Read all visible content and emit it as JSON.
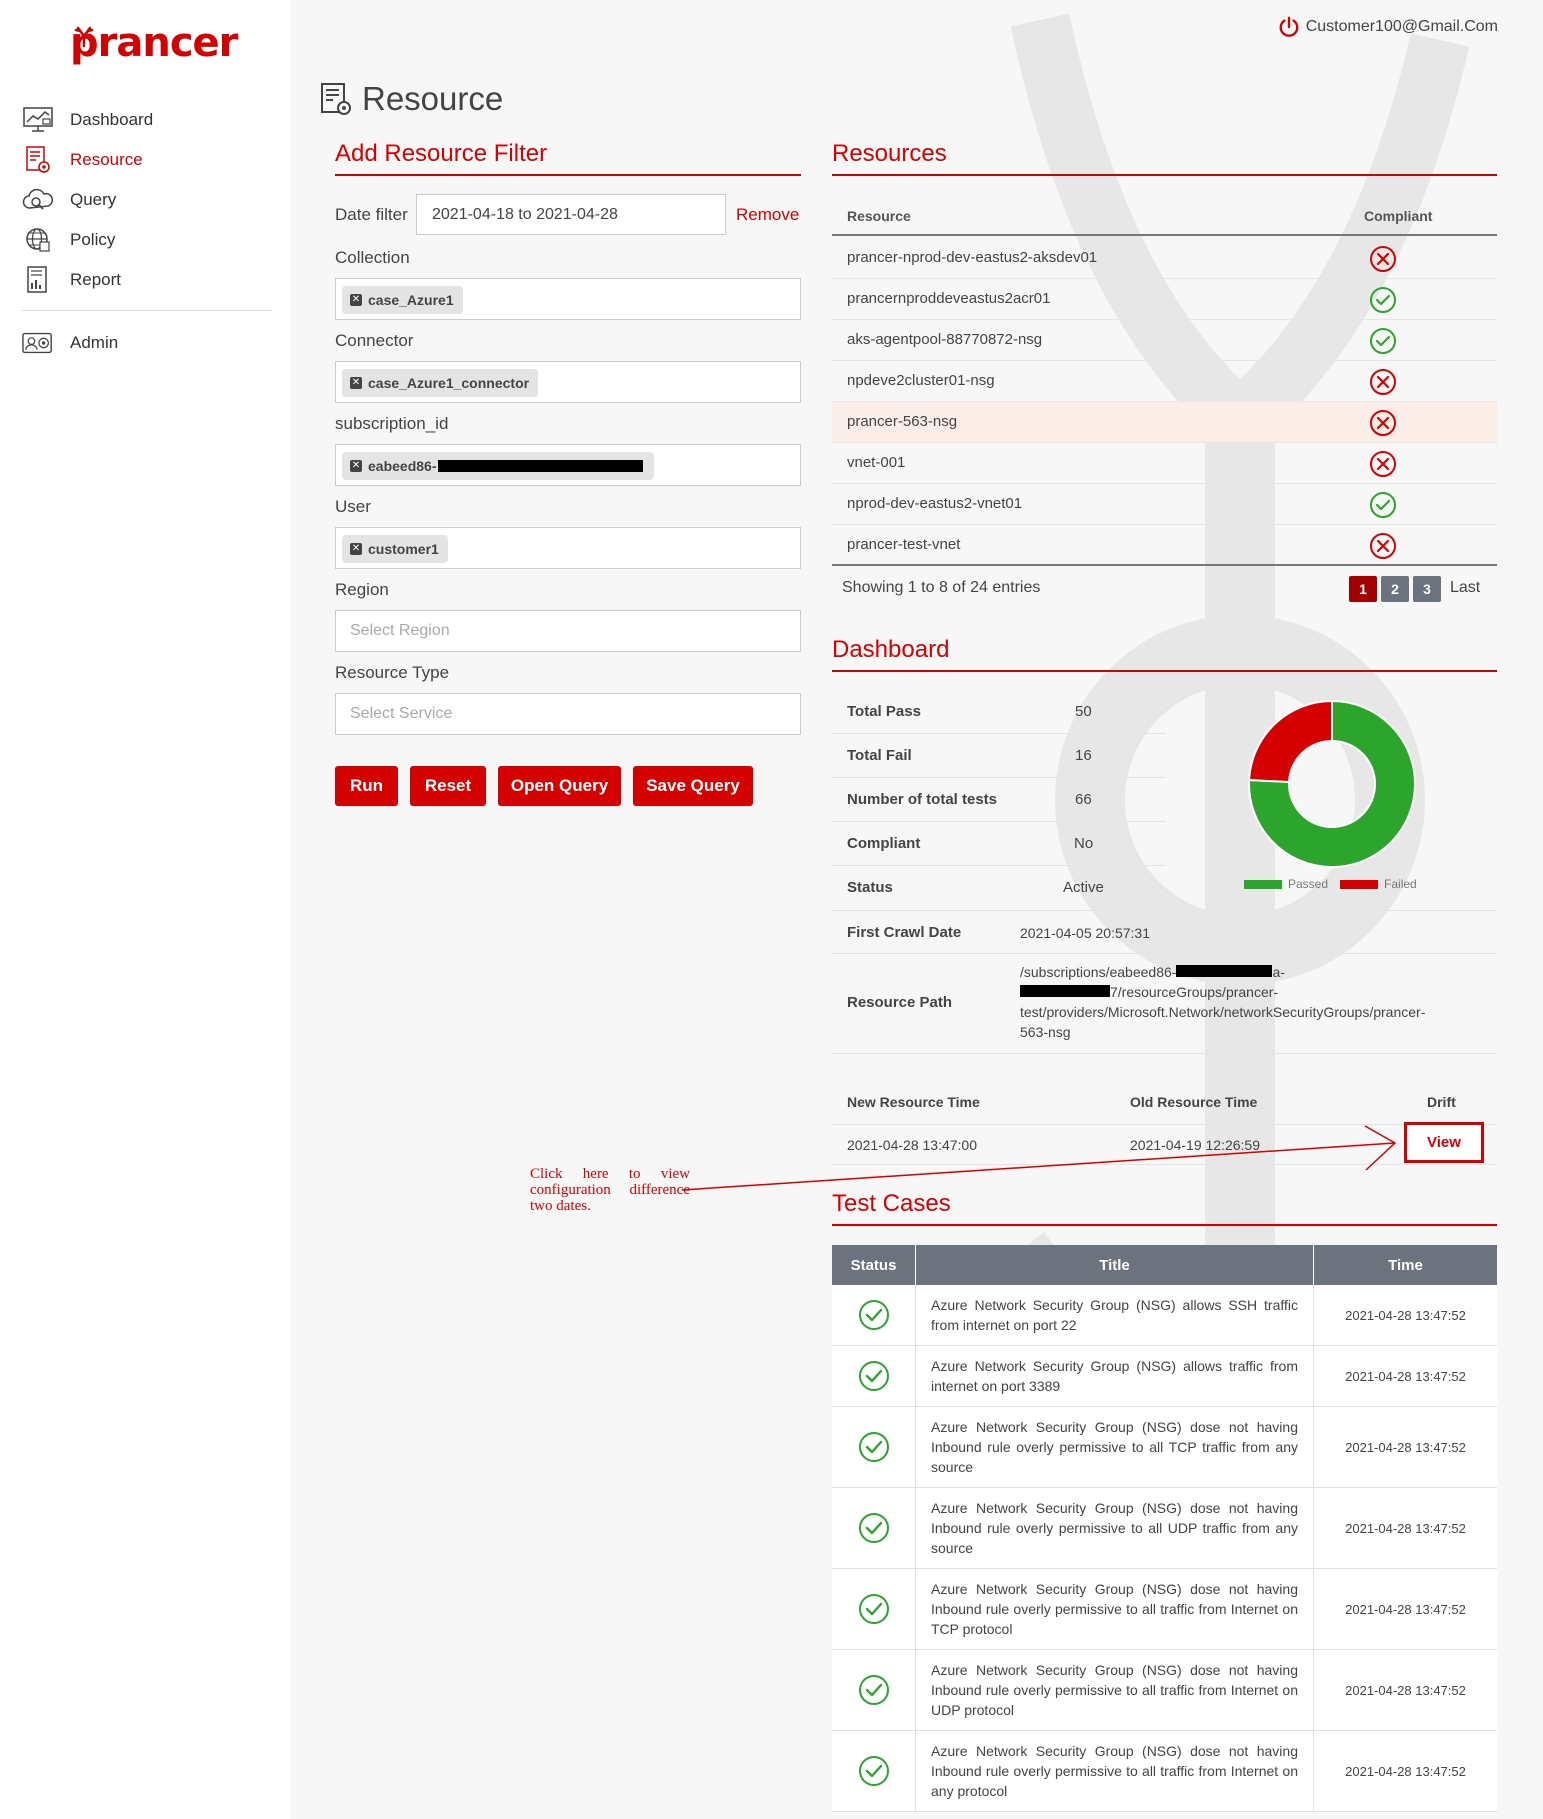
{
  "app": {
    "logo": "prancer",
    "user": "Customer100@Gmail.Com"
  },
  "sidebar": {
    "items": [
      {
        "label": "Dashboard",
        "icon": "dashboard-icon"
      },
      {
        "label": "Resource",
        "icon": "resource-icon"
      },
      {
        "label": "Query",
        "icon": "query-icon"
      },
      {
        "label": "Policy",
        "icon": "policy-icon"
      },
      {
        "label": "Report",
        "icon": "report-icon"
      },
      {
        "label": "Admin",
        "icon": "admin-icon"
      }
    ],
    "active": "Resource"
  },
  "page": {
    "title": "Resource"
  },
  "filter": {
    "title": "Add Resource Filter",
    "date_label": "Date filter",
    "date_value": "2021-04-18 to 2021-04-28",
    "remove": "Remove",
    "collection_label": "Collection",
    "collection_tag": "case_Azure1",
    "connector_label": "Connector",
    "connector_tag": "case_Azure1_connector",
    "subscription_label": "subscription_id",
    "subscription_tag": "eabeed86-",
    "user_label": "User",
    "user_tag": "customer1",
    "region_label": "Region",
    "region_placeholder": "Select Region",
    "type_label": "Resource Type",
    "type_placeholder": "Select Service",
    "buttons": {
      "run": "Run",
      "reset": "Reset",
      "open": "Open Query",
      "save": "Save Query"
    }
  },
  "resources": {
    "title": "Resources",
    "col_resource": "Resource",
    "col_compliant": "Compliant",
    "rows": [
      {
        "name": "prancer-nprod-dev-eastus2-aksdev01",
        "compliant": false
      },
      {
        "name": "prancernproddeveastus2acr01",
        "compliant": true
      },
      {
        "name": "aks-agentpool-88770872-nsg",
        "compliant": true
      },
      {
        "name": "npdeve2cluster01-nsg",
        "compliant": false
      },
      {
        "name": "prancer-563-nsg",
        "compliant": false,
        "selected": true
      },
      {
        "name": "vnet-001",
        "compliant": false
      },
      {
        "name": "nprod-dev-eastus2-vnet01",
        "compliant": true
      },
      {
        "name": "prancer-test-vnet",
        "compliant": false
      }
    ],
    "showing": "Showing 1 to 8 of 24 entries",
    "pages": [
      "1",
      "2",
      "3"
    ],
    "last": "Last"
  },
  "dashboard": {
    "title": "Dashboard",
    "total_pass_label": "Total Pass",
    "total_pass": "50",
    "total_fail_label": "Total Fail",
    "total_fail": "16",
    "total_tests_label": "Number of total tests",
    "total_tests": "66",
    "compliant_label": "Compliant",
    "compliant": "No",
    "status_label": "Status",
    "status": "Active",
    "first_crawl_label": "First Crawl Date",
    "first_crawl": "2021-04-05 20:57:31",
    "path_label": "Resource Path",
    "path_line1": "/subscriptions/eabeed86-",
    "path_line1_end": "a-",
    "path_line2": "7/resourceGroups/prancer-",
    "path_line3": "test/providers/Microsoft.Network/networkSecurityGroups/prancer-",
    "path_line4": "563-nsg",
    "new_time_label": "New Resource Time",
    "old_time_label": "Old Resource Time",
    "drift_label": "Drift",
    "new_time": "2021-04-28 13:47:00",
    "old_time": "2021-04-19 12:26:59",
    "view": "View",
    "legend_passed": "Passed",
    "legend_failed": "Failed",
    "colors": {
      "passed": "#2ca52c",
      "failed": "#d50000"
    }
  },
  "chart_data": {
    "type": "pie",
    "categories": [
      "Passed",
      "Failed"
    ],
    "values": [
      50,
      16
    ],
    "legend": "bottom"
  },
  "annotation": "Click here to view configuration difference two dates.",
  "test_cases": {
    "title": "Test Cases",
    "columns": [
      "Status",
      "Title",
      "Time"
    ],
    "rows": [
      {
        "title": "Azure Network Security Group (NSG) allows SSH traffic from internet on port 22",
        "time": "2021-04-28 13:47:52"
      },
      {
        "title": "Azure Network Security Group (NSG) allows traffic from internet on port 3389",
        "time": "2021-04-28 13:47:52"
      },
      {
        "title": "Azure Network Security Group (NSG) dose not having Inbound rule overly permissive to all TCP traffic from any source",
        "time": "2021-04-28 13:47:52"
      },
      {
        "title": "Azure Network Security Group (NSG) dose not having Inbound rule overly permissive to all UDP traffic from any source",
        "time": "2021-04-28 13:47:52"
      },
      {
        "title": "Azure Network Security Group (NSG) dose not having Inbound rule overly permissive to all traffic from Internet on TCP protocol",
        "time": "2021-04-28 13:47:52"
      },
      {
        "title": "Azure Network Security Group (NSG) dose not having Inbound rule overly permissive to all traffic from Internet on UDP protocol",
        "time": "2021-04-28 13:47:52"
      },
      {
        "title": "Azure Network Security Group (NSG) dose not having Inbound rule overly permissive to all traffic from Internet on any protocol",
        "time": "2021-04-28 13:47:52"
      }
    ]
  }
}
